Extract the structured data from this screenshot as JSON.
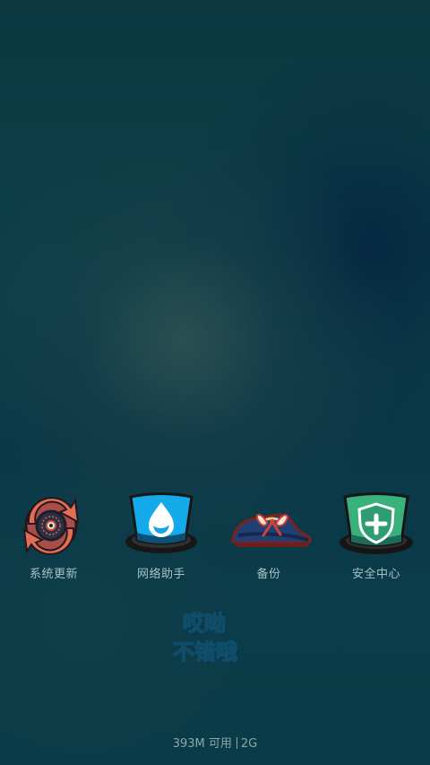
{
  "apps": [
    {
      "label": "系统更新",
      "icon": "system-update-icon"
    },
    {
      "label": "网络助手",
      "icon": "network-assistant-hat-icon"
    },
    {
      "label": "备份",
      "icon": "backup-shoe-icon"
    },
    {
      "label": "安全中心",
      "icon": "security-center-hat-icon"
    }
  ],
  "mascot_text": {
    "line1": "哎呦",
    "line2": "不错哦"
  },
  "status": {
    "memory": "393M 可用",
    "total": "2G"
  },
  "colors": {
    "background": "#0d3a45",
    "system_update": "#d76d55",
    "network_hat": "#14a9e8",
    "backup_shoe": "#203f74",
    "security_hat": "#39b17b",
    "mascot_text": "#1f73a0"
  }
}
